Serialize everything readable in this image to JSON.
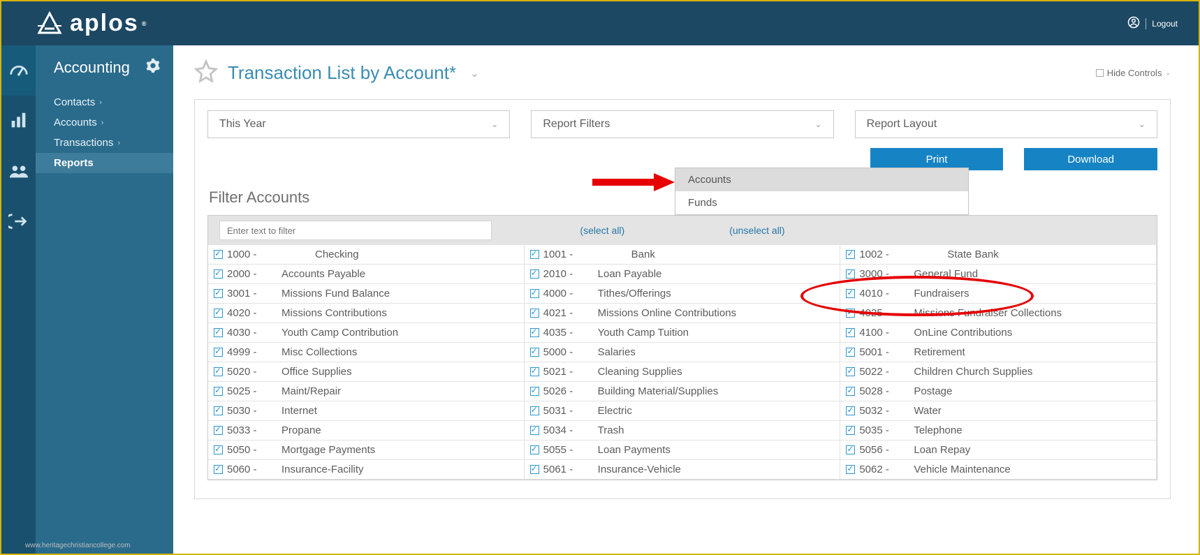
{
  "brand": "aplos",
  "logout_label": "Logout",
  "sidebar": {
    "title": "Accounting",
    "links": [
      {
        "label": "Contacts",
        "has_sub": true
      },
      {
        "label": "Accounts",
        "has_sub": true
      },
      {
        "label": "Transactions",
        "has_sub": true
      },
      {
        "label": "Reports",
        "has_sub": false,
        "active": true
      }
    ]
  },
  "page": {
    "title": "Transaction List by Account*",
    "hide_controls": "Hide Controls",
    "period_label": "This Year",
    "report_filters_label": "Report Filters",
    "report_layout_label": "Report Layout",
    "print_label": "Print",
    "download_label": "Download",
    "filter_title": "Filter Accounts",
    "filter_placeholder": "Enter text to filter",
    "select_all": "(select all)",
    "unselect_all": "(unselect all)"
  },
  "dropdown": {
    "items": [
      "Accounts",
      "Funds"
    ]
  },
  "accounts": [
    {
      "code": "1000 -",
      "name": "Checking",
      "first": true
    },
    {
      "code": "1001 -",
      "name": "Bank",
      "first": true
    },
    {
      "code": "1002 -",
      "name": "State Bank",
      "first": true
    },
    {
      "code": "2000 -",
      "name": "Accounts Payable"
    },
    {
      "code": "2010 -",
      "name": "Loan Payable"
    },
    {
      "code": "3000 -",
      "name": "General Fund"
    },
    {
      "code": "3001 -",
      "name": "Missions Fund Balance"
    },
    {
      "code": "4000 -",
      "name": "Tithes/Offerings"
    },
    {
      "code": "4010 -",
      "name": "Fundraisers"
    },
    {
      "code": "4020 -",
      "name": "Missions Contributions"
    },
    {
      "code": "4021 -",
      "name": "Missions Online Contributions"
    },
    {
      "code": "4025 -",
      "name": "Missions Fundraiser Collections"
    },
    {
      "code": "4030 -",
      "name": "Youth Camp Contribution"
    },
    {
      "code": "4035 -",
      "name": "Youth Camp Tuition"
    },
    {
      "code": "4100 -",
      "name": "OnLine Contributions"
    },
    {
      "code": "4999 -",
      "name": "Misc Collections"
    },
    {
      "code": "5000 -",
      "name": "Salaries"
    },
    {
      "code": "5001 -",
      "name": "Retirement"
    },
    {
      "code": "5020 -",
      "name": "Office Supplies"
    },
    {
      "code": "5021 -",
      "name": "Cleaning Supplies"
    },
    {
      "code": "5022 -",
      "name": "Children Church Supplies"
    },
    {
      "code": "5025 -",
      "name": "Maint/Repair"
    },
    {
      "code": "5026 -",
      "name": "Building Material/Supplies"
    },
    {
      "code": "5028 -",
      "name": "Postage"
    },
    {
      "code": "5030 -",
      "name": "Internet"
    },
    {
      "code": "5031 -",
      "name": "Electric"
    },
    {
      "code": "5032 -",
      "name": "Water"
    },
    {
      "code": "5033 -",
      "name": "Propane"
    },
    {
      "code": "5034 -",
      "name": "Trash"
    },
    {
      "code": "5035 -",
      "name": "Telephone"
    },
    {
      "code": "5050 -",
      "name": "Mortgage Payments"
    },
    {
      "code": "5055 -",
      "name": "Loan Payments"
    },
    {
      "code": "5056 -",
      "name": "Loan Repay"
    },
    {
      "code": "5060 -",
      "name": "Insurance-Facility"
    },
    {
      "code": "5061 -",
      "name": "Insurance-Vehicle"
    },
    {
      "code": "5062 -",
      "name": "Vehicle Maintenance"
    }
  ],
  "watermark": "www.heritagechristiancollege.com"
}
